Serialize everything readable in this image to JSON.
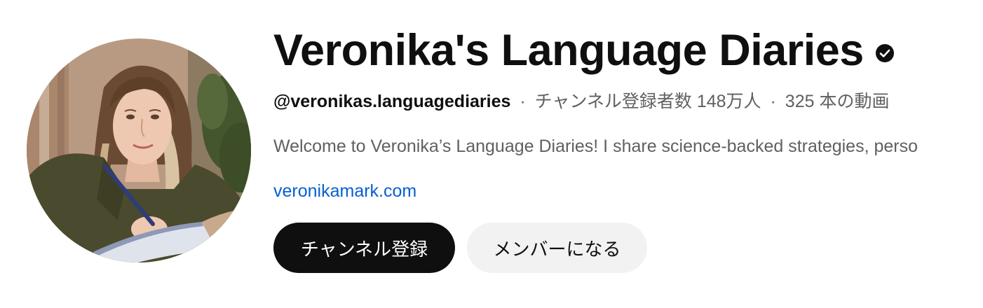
{
  "channel": {
    "title": "Veronika's Language Diaries",
    "verified": true,
    "handle": "@veronikas.languagediaries",
    "subscribers": "チャンネル登録者数 148万人",
    "videos": "325 本の動画",
    "separator": "·",
    "description": "Welcome to Veronika’s Language Diaries! I share science-backed strategies, perso",
    "link": "veronikamark.com"
  },
  "actions": {
    "subscribe_label": "チャンネル登録",
    "join_label": "メンバーになる"
  },
  "icons": {
    "verified": "verified-check-icon"
  },
  "colors": {
    "subscribe_bg": "#0f0f0f",
    "join_bg": "#f2f2f2",
    "link": "#065fd4",
    "muted_text": "#606060"
  }
}
